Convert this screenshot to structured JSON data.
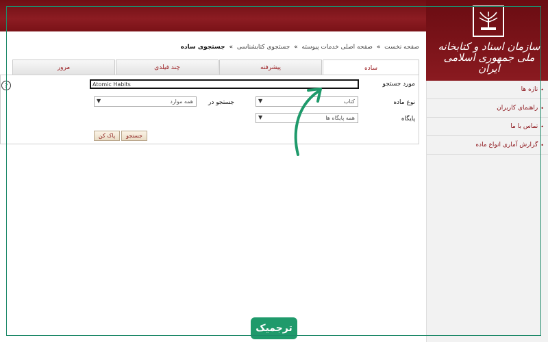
{
  "header": {
    "logo_title": "سازمان اسناد و کتابخانه ملی جمهوری اسلامی ایران"
  },
  "sidebar": {
    "items": [
      {
        "label": "تازه ها"
      },
      {
        "label": "راهنمای کاربران"
      },
      {
        "label": "تماس با ما"
      },
      {
        "label": "گزارش آماری انواع ماده"
      }
    ]
  },
  "breadcrumb": {
    "items": [
      "صفحه نخست",
      "صفحه اصلی خدمات پیوسته",
      "جستجوی کتابشناسی"
    ],
    "current": "جستجوی ساده",
    "separator": "»"
  },
  "tabs": [
    {
      "label": "ساده",
      "active": true
    },
    {
      "label": "پیشرفته",
      "active": false
    },
    {
      "label": "چند فیلدی",
      "active": false
    },
    {
      "label": "مرور",
      "active": false
    }
  ],
  "form": {
    "search_term_label": "مورد جستجو",
    "search_term_value": "Atomic Habits",
    "material_type_label": "نوع ماده",
    "material_type_value": "کتاب",
    "search_in_label": "جستجو در",
    "search_in_value": "همه موارد",
    "database_label": "پایگاه",
    "database_value": "همه پایگاه ها",
    "search_button": "جستجو",
    "clear_button": "پاک کن"
  },
  "brand": {
    "label": "ترجمیک"
  },
  "colors": {
    "header": "#8c1c22",
    "accent_green": "#1f9a6b"
  }
}
